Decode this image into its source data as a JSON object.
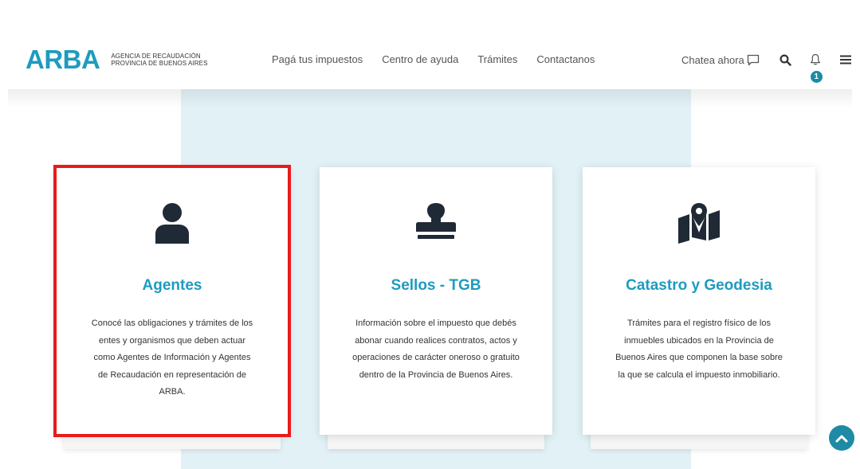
{
  "header": {
    "logo_text": "ARBA",
    "logo_sub_line1": "AGENCIA DE RECAUDACIÓN",
    "logo_sub_line2": "PROVINCIA DE BUENOS AIRES",
    "nav": [
      {
        "label": "Pagá tus impuestos"
      },
      {
        "label": "Centro de ayuda"
      },
      {
        "label": "Trámites"
      },
      {
        "label": "Contactanos"
      }
    ],
    "chat_label": "Chatea ahora",
    "notification_count": "1"
  },
  "cards": [
    {
      "title": "Agentes",
      "icon": "user-icon",
      "description": "Conocé las obligaciones y trámites de los entes y organismos que deben actuar como Agentes de Información y Agentes de Recaudación en representación de ARBA.",
      "selected": true
    },
    {
      "title": "Sellos - TGB",
      "icon": "stamp-icon",
      "description": "Información sobre el impuesto que debés abonar cuando realices contratos, actos y operaciones de carácter oneroso o gratuito dentro de la Provincia de Buenos Aires.",
      "selected": false
    },
    {
      "title": "Catastro y Geodesia",
      "icon": "map-location-icon",
      "description": "Trámites para el registro físico de los inmuebles ubicados en la Provincia de Buenos Aires que componen la base sobre la que se calcula el impuesto inmobiliario.",
      "selected": false
    }
  ],
  "colors": {
    "brand": "#1e9bbf",
    "accent_dark": "#1e8aa6",
    "selection_outline": "#e81b1b",
    "backdrop": "#e2f1f6",
    "icon_dark": "#202a36"
  }
}
